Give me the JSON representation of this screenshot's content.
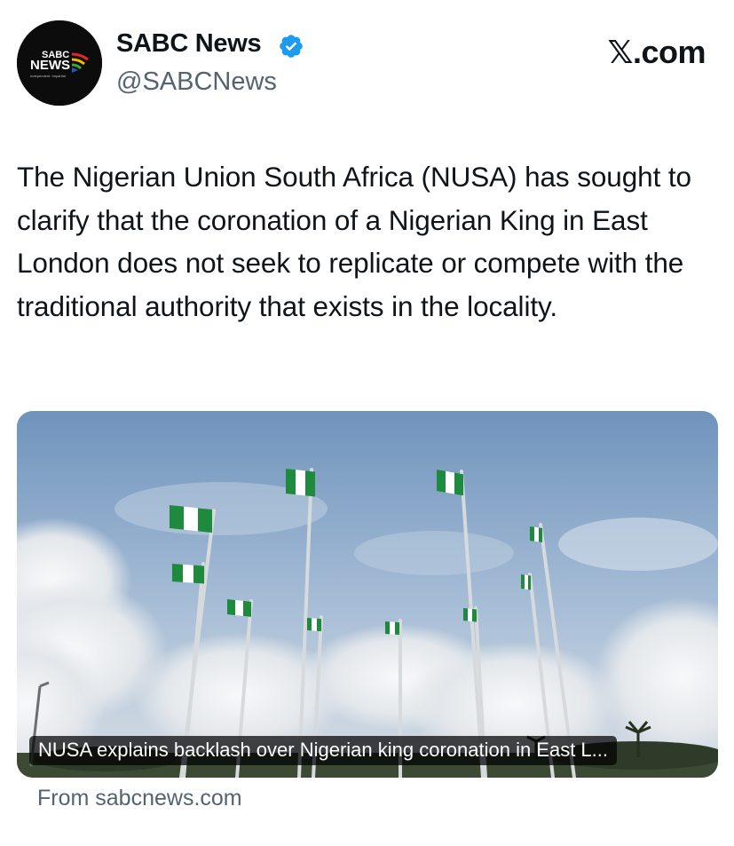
{
  "post": {
    "author": {
      "display_name": "SABC News",
      "handle": "@SABCNews",
      "verified": true,
      "avatar": {
        "logo_line1": "SABC",
        "logo_line2": "NEWS",
        "logo_tagline": "Independent. Impartial."
      }
    },
    "platform_label": "𝕏.com",
    "text": "The Nigerian Union South Africa (NUSA) has sought to clarify that the coronation of a Nigerian King in East London does not seek to replicate or compete with the traditional authority that exists in the locality.",
    "link_card": {
      "image_description_icon": "nigerian-flags-photo",
      "caption": "NUSA explains backlash over Nigerian king coronation in East L...",
      "source": "From sabcnews.com"
    }
  },
  "colors": {
    "text_primary": "#0f1419",
    "text_secondary": "#536471",
    "verified_badge": "#1d9bf0",
    "flag_green": "#1e8a3e",
    "sky": "#7e9fc4"
  }
}
